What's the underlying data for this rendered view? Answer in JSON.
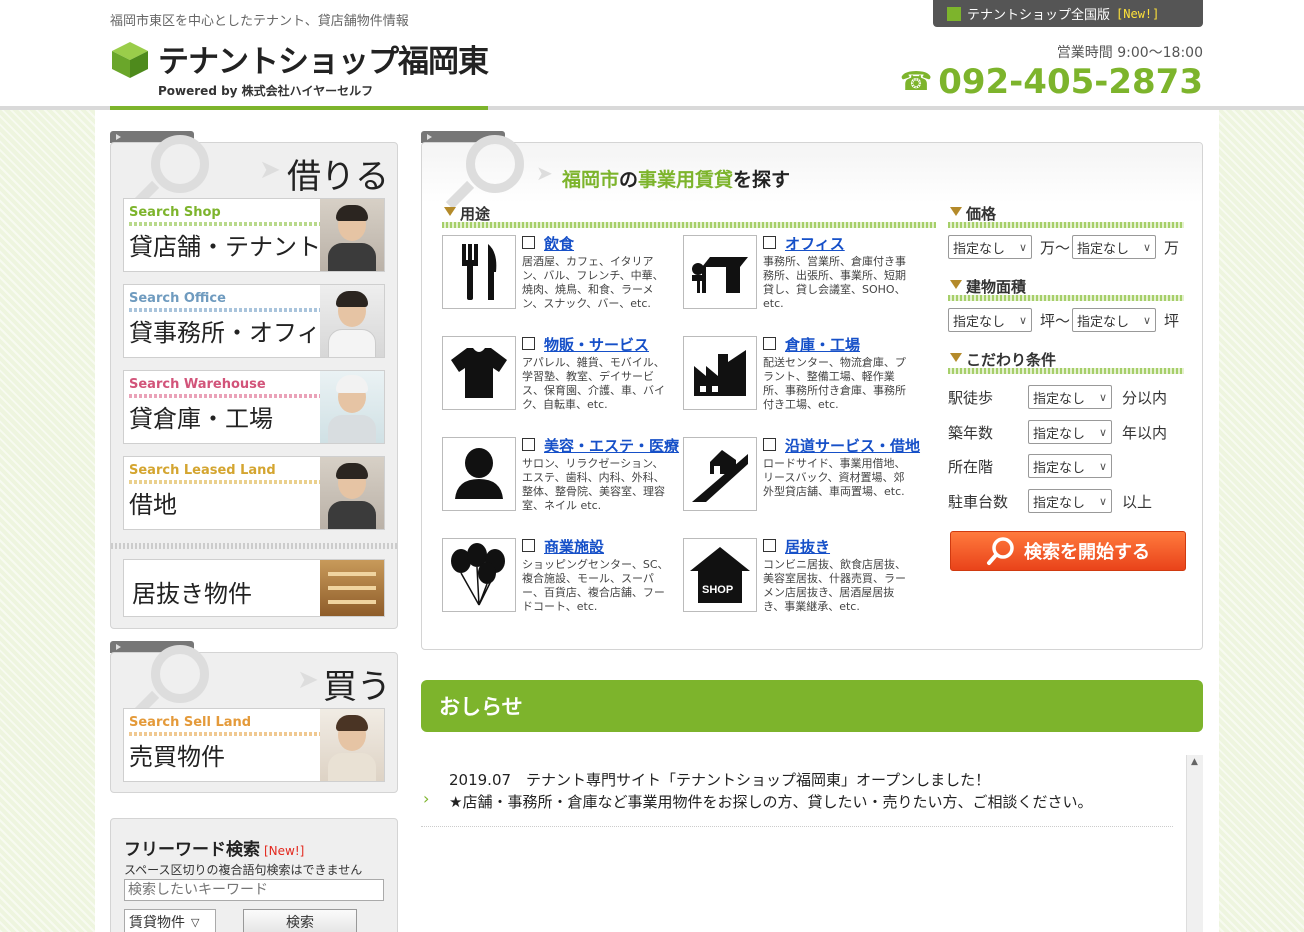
{
  "header": {
    "tagline": "福岡市東区を中心としたテナント、貸店舗物件情報",
    "logo_title": "テナントショップ福岡東",
    "logo_sub": "Powered by 株式会社ハイヤーセルフ",
    "nation_label": "テナントショップ全国版",
    "nation_new": "[New!]",
    "hours": "営業時間 9:00～18:00",
    "phone": "092-405-2873"
  },
  "sidebar": {
    "rent_title": "借りる",
    "rent_items": [
      {
        "en": "Search Shop",
        "jp": "貸店舗・テナント"
      },
      {
        "en": "Search Office",
        "jp": "貸事務所・オフィス"
      },
      {
        "en": "Search Warehouse",
        "jp": "貸倉庫・工場"
      },
      {
        "en": "Search Leased Land",
        "jp": "借地"
      }
    ],
    "inuki": "居抜き物件",
    "buy_title": "買う",
    "buy_item": {
      "en": "Search Sell Land",
      "jp": "売買物件"
    }
  },
  "freeword": {
    "title": "フリーワード検索",
    "new": "[New!]",
    "note": "スペース区切りの複合語句検索はできません",
    "placeholder": "検索したいキーワード",
    "select_value": "賃貸物件",
    "button": "検索"
  },
  "search": {
    "title_city": "福岡市",
    "title_no": "の",
    "title_type": "事業用賃貸",
    "title_suffix": "を探す",
    "usage_head": "用途",
    "categories": [
      {
        "title": "飲食",
        "desc": "居酒屋、カフェ、イタリアン、バル、フレンチ、中華、焼肉、焼鳥、和食、ラーメン、スナック、バー、etc."
      },
      {
        "title": "オフィス",
        "desc": "事務所、営業所、倉庫付き事務所、出張所、事業所、短期貸し、貸し会議室、SOHO、etc."
      },
      {
        "title": "物販・サービス",
        "desc": "アパレル、雑貨、モバイル、学習塾、教室、デイサービス、保育園、介護、車、バイク、自転車、etc."
      },
      {
        "title": "倉庫・工場",
        "desc": "配送センター、物流倉庫、プラント、整備工場、軽作業所、事務所付き倉庫、事務所付き工場、etc."
      },
      {
        "title": "美容・エステ・医療",
        "desc": "サロン、リラクゼーション、エステ、歯科、内科、外科、整体、整骨院、美容室、理容室、ネイル etc."
      },
      {
        "title": "沿道サービス・借地",
        "desc": "ロードサイド、事業用借地、リースバック、資材置場、郊外型貸店舗、車両置場、etc."
      },
      {
        "title": "商業施設",
        "desc": "ショッピングセンター、SC、複合施設、モール、スーパー、百貨店、複合店舗、フードコート、etc."
      },
      {
        "title": "居抜き",
        "desc": "コンビニ居抜、飲食店居抜、美容室居抜、什器売買、ラーメン店居抜き、居酒屋居抜き、事業継承、etc."
      }
    ],
    "price_head": "価格",
    "price_unit_from": "万～",
    "price_unit_to": "万",
    "area_head": "建物面積",
    "area_unit_from": "坪～",
    "area_unit_to": "坪",
    "cond_head": "こだわり条件",
    "unspecified": "指定なし",
    "conditions": [
      {
        "label": "駅徒歩",
        "unit": "分以内"
      },
      {
        "label": "築年数",
        "unit": "年以内"
      },
      {
        "label": "所在階",
        "unit": ""
      },
      {
        "label": "駐車台数",
        "unit": "以上"
      }
    ],
    "search_button": "検索を開始する"
  },
  "news": {
    "head": "おしらせ",
    "items": [
      {
        "line1": "2019.07　テナント専門サイト「テナントショップ福岡東」オープンしました！",
        "line2": "★店舗・事務所・倉庫など事業用物件をお探しの方、貸したい・売りたい方、ご相談ください。"
      }
    ]
  },
  "colors": {
    "brand_green": "#7db42c",
    "search_orange": "#ef5a23",
    "link_blue": "#1650c8"
  }
}
